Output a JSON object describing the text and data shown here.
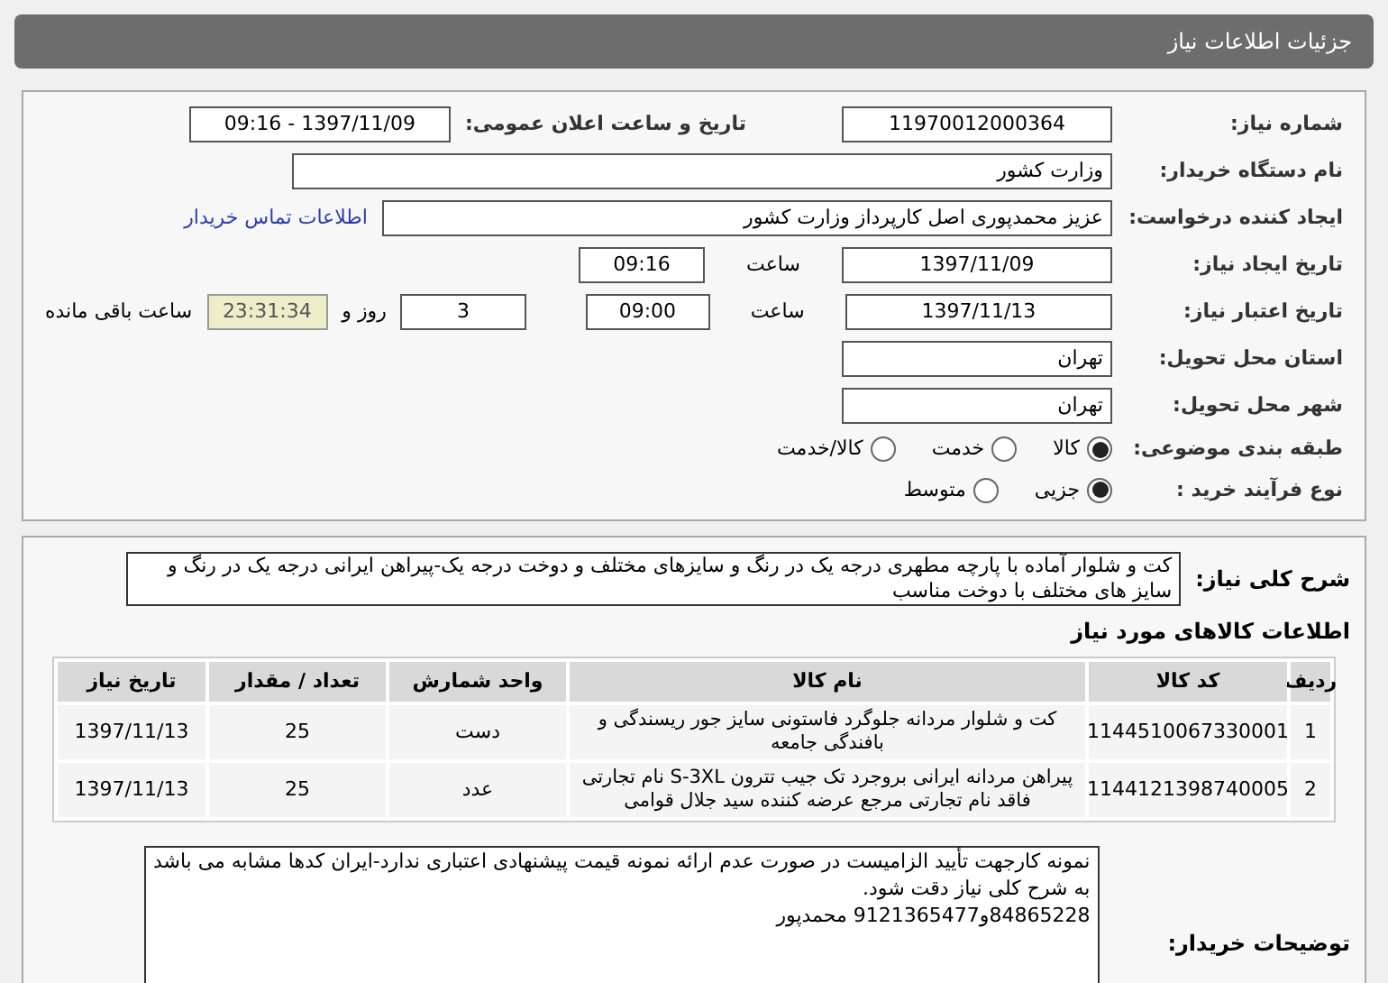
{
  "header": {
    "title": "جزئیات اطلاعات نیاز"
  },
  "need_number": {
    "label": "شماره نیاز:",
    "value": "11970012000364"
  },
  "announce": {
    "label": "تاریخ و ساعت اعلان عمومی:",
    "value": "1397/11/09 - 09:16"
  },
  "buyer_org": {
    "label": "نام دستگاه خریدار:",
    "value": "وزارت کشور"
  },
  "requester": {
    "label": "ایجاد کننده درخواست:",
    "value": "عزیز محمدپوری اصل کارپرداز وزارت کشور",
    "link": "اطلاعات تماس خریدار"
  },
  "created": {
    "label": "تاریخ ایجاد نیاز:",
    "date": "1397/11/09",
    "time_label": "ساعت",
    "time": "09:16"
  },
  "validity": {
    "label": "تاریخ اعتبار نیاز:",
    "date": "1397/11/13",
    "time_label": "ساعت",
    "time": "09:00",
    "days": "3",
    "days_label": "روز و",
    "remaining": "23:31:34",
    "remaining_label": "ساعت باقی مانده"
  },
  "province": {
    "label": "استان محل تحویل:",
    "value": "تهران"
  },
  "city": {
    "label": "شهر محل تحویل:",
    "value": "تهران"
  },
  "category": {
    "label": "طبقه بندی موضوعی:",
    "options": [
      {
        "label": "کالا",
        "selected": true
      },
      {
        "label": "خدمت",
        "selected": false
      },
      {
        "label": "کالا/خدمت",
        "selected": false
      }
    ]
  },
  "process": {
    "label": "نوع فرآیند خرید :",
    "options": [
      {
        "label": "جزیی",
        "selected": true
      },
      {
        "label": "متوسط",
        "selected": false
      }
    ]
  },
  "description": {
    "label": "شرح کلی نیاز:",
    "value": "کت و شلوار آماده با پارچه مطهری درجه یک در رنگ و سایزهای مختلف و دوخت درجه یک-پیراهن ایرانی درجه یک در رنگ و سایز های مختلف با دوخت مناسب"
  },
  "items": {
    "title": "اطلاعات کالاهای مورد نیاز",
    "columns": [
      "ردیف",
      "کد کالا",
      "نام کالا",
      "واحد شمارش",
      "تعداد / مقدار",
      "تاریخ نیاز"
    ],
    "rows": [
      [
        "1",
        "1144510067330001",
        "کت و شلوار مردانه جلوگرد فاستونی سایز جور ریسندگی و بافندگی جامعه",
        "دست",
        "25",
        "1397/11/13"
      ],
      [
        "2",
        "1144121398740005",
        "پیراهن مردانه ایرانی بروجرد تک جیب تترون S-3XL نام تجارتی فاقد نام تجارتی مرجع عرضه کننده سید جلال قوامی",
        "عدد",
        "25",
        "1397/11/13"
      ]
    ]
  },
  "buyer_notes": {
    "label": "توضیحات خریدار:",
    "lines": [
      "نمونه کارجهت تأیید الزامیست در صورت عدم ارائه نمونه قیمت پیشنهادی اعتباری ندارد-ایران کدها مشابه می باشد به شرح کلی نیاز دقت شود.",
      "84865228و9121365477 محمدپور"
    ]
  }
}
